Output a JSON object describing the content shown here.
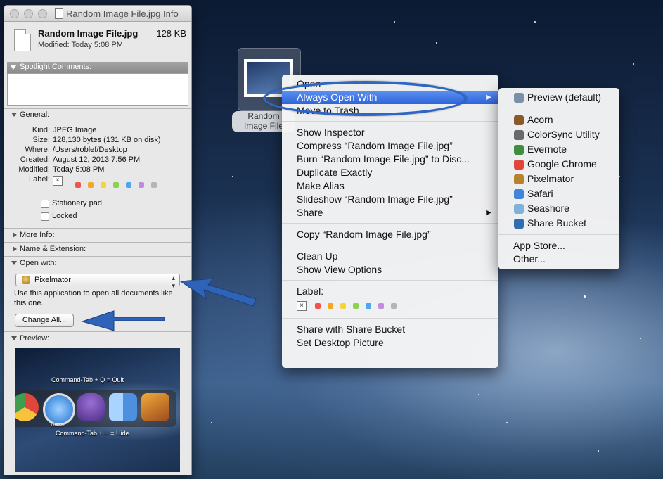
{
  "info_window": {
    "title": "Random Image File.jpg Info",
    "file_name": "Random Image File.jpg",
    "file_size": "128 KB",
    "modified_line": "Modified: Today 5:08 PM",
    "spotlight_label": "Spotlight Comments:",
    "general_label": "General:",
    "general": [
      {
        "key": "Kind:",
        "value": "JPEG Image"
      },
      {
        "key": "Size:",
        "value": "128,130 bytes (131 KB on disk)"
      },
      {
        "key": "Where:",
        "value": "/Users/roblef/Desktop"
      },
      {
        "key": "Created:",
        "value": "August 12, 2013 7:56 PM"
      },
      {
        "key": "Modified:",
        "value": "Today 5:08 PM"
      },
      {
        "key": "Label:",
        "value": ""
      }
    ],
    "label_colors": [
      "#f2544a",
      "#f5a623",
      "#f6d33c",
      "#8ad34b",
      "#4fa6ec",
      "#c28bde",
      "#b5b5b5"
    ],
    "stationery_label": "Stationery pad",
    "locked_label": "Locked",
    "more_info_label": "More Info:",
    "name_ext_label": "Name & Extension:",
    "open_with_label": "Open with:",
    "open_with_app": "Pixelmator",
    "open_with_help": "Use this application to open all documents like this one.",
    "change_all_label": "Change All...",
    "preview_label": "Preview:",
    "preview_caption_top": "Command-Tab + Q = Quit",
    "preview_caption_bottom": "Command-Tab + H = Hide",
    "preview_app_name": "iTunes"
  },
  "desktop_icon": {
    "label_line1": "Random",
    "label_line2": "Image File"
  },
  "context_menu": {
    "groups": [
      [
        "Open",
        "Always Open With",
        "Move to Trash"
      ],
      [
        "Show Inspector",
        "Compress “Random Image File.jpg”",
        "Burn “Random Image File.jpg” to Disc...",
        "Duplicate Exactly",
        "Make Alias",
        "Slideshow “Random Image File.jpg”",
        "Share"
      ],
      [
        "Copy “Random Image File.jpg”"
      ],
      [
        "Clean Up",
        "Show View Options"
      ],
      [
        "Label:"
      ],
      [
        "Share with Share Bucket",
        "Set Desktop Picture"
      ]
    ],
    "selected": "Always Open With",
    "label_colors": [
      "#f2544a",
      "#f5a623",
      "#f6d33c",
      "#8ad34b",
      "#4fa6ec",
      "#c28bde",
      "#b5b5b5"
    ]
  },
  "submenu": {
    "default_app": "Preview (default)",
    "apps": [
      "Acorn",
      "ColorSync Utility",
      "Evernote",
      "Google Chrome",
      "Pixelmator",
      "Safari",
      "Seashore",
      "Share Bucket"
    ],
    "footer": [
      "App Store...",
      "Other..."
    ],
    "icon_colors": [
      "#8a5a2b",
      "#6a6a6a",
      "#3f8d3f",
      "#e0463a",
      "#b8822d",
      "#3f86d8",
      "#7fb2d9",
      "#2f6fb1"
    ],
    "preview_icon_color": "#7a8fa8"
  },
  "colors": {
    "highlight": "#3a6fe0",
    "annotation_blue": "#2e63b8"
  }
}
